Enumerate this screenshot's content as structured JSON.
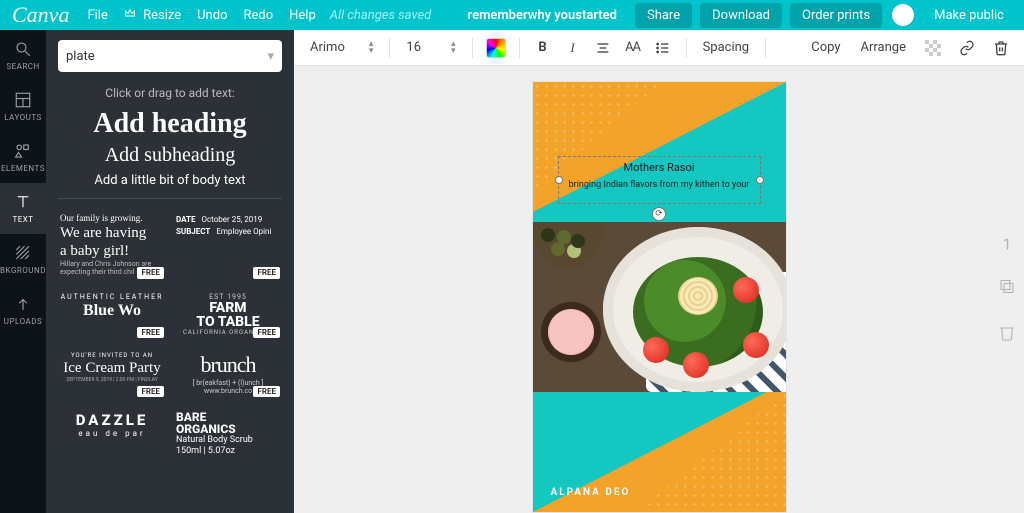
{
  "topbar": {
    "logo": "Canva",
    "menu": {
      "file": "File",
      "resize": "Resize",
      "undo": "Undo",
      "redo": "Redo",
      "help": "Help"
    },
    "saved": "All changes saved",
    "docname": "rememberwhy youstarted",
    "share": "Share",
    "download": "Download",
    "order": "Order prints",
    "makepublic": "Make public"
  },
  "rail": {
    "search": "SEARCH",
    "layouts": "LAYOUTS",
    "elements": "ELEMENTS",
    "text": "TEXT",
    "bkground": "BKGROUND",
    "uploads": "UPLOADS"
  },
  "panel": {
    "search_value": "plate",
    "hint": "Click or drag to add text:",
    "heading": "Add heading",
    "subheading": "Add subheading",
    "body": "Add a little bit of body text",
    "free_label": "FREE",
    "templates": {
      "family": {
        "l1": "Our family is growing.",
        "l2a": "We are having",
        "l2b": "a baby girl!",
        "l3": "Hillary and Chris Johnson are expecting their third chil"
      },
      "memo": {
        "date_lab": "DATE",
        "date_val": "October 25, 2019",
        "subj_lab": "SUBJECT",
        "subj_val": "Employee Opini"
      },
      "farm": {
        "est": "EST 1995",
        "l1": "FARM",
        "l2": "TO TABLE",
        "sub": "CALIFORNIA ORGANIC FA"
      },
      "leather": {
        "t1": "AUTHENTIC LEATHER",
        "t2": "Blue Wo"
      },
      "brunch": {
        "big": "brunch",
        "sub1": "[ br(eakfast) + (l)unch ]",
        "sub2": "www.brunch.co"
      },
      "ice": {
        "t1": "YOU'RE INVITED TO AN",
        "t2": "Ice Cream Party",
        "t3": "SEPTEMBER 9, 2019 | 2:00 PM | FINDLAY"
      },
      "dazzle": {
        "t1": "DAZZLE",
        "t2": "eau de par"
      },
      "bare": {
        "t1a": "BARE",
        "t1b": "ORGANICS",
        "t2": "Natural Body Scrub",
        "t3": "150ml | 5.07oz"
      }
    }
  },
  "toolbar": {
    "font": "Arimo",
    "size": "16",
    "spacing": "Spacing",
    "copy": "Copy",
    "arrange": "Arrange"
  },
  "canvas": {
    "title": "Mothers Rasoi",
    "subtitle": "bringing Indian flavors from my kithen to your",
    "footer": "ALPANA DEO",
    "page_number": "1"
  }
}
